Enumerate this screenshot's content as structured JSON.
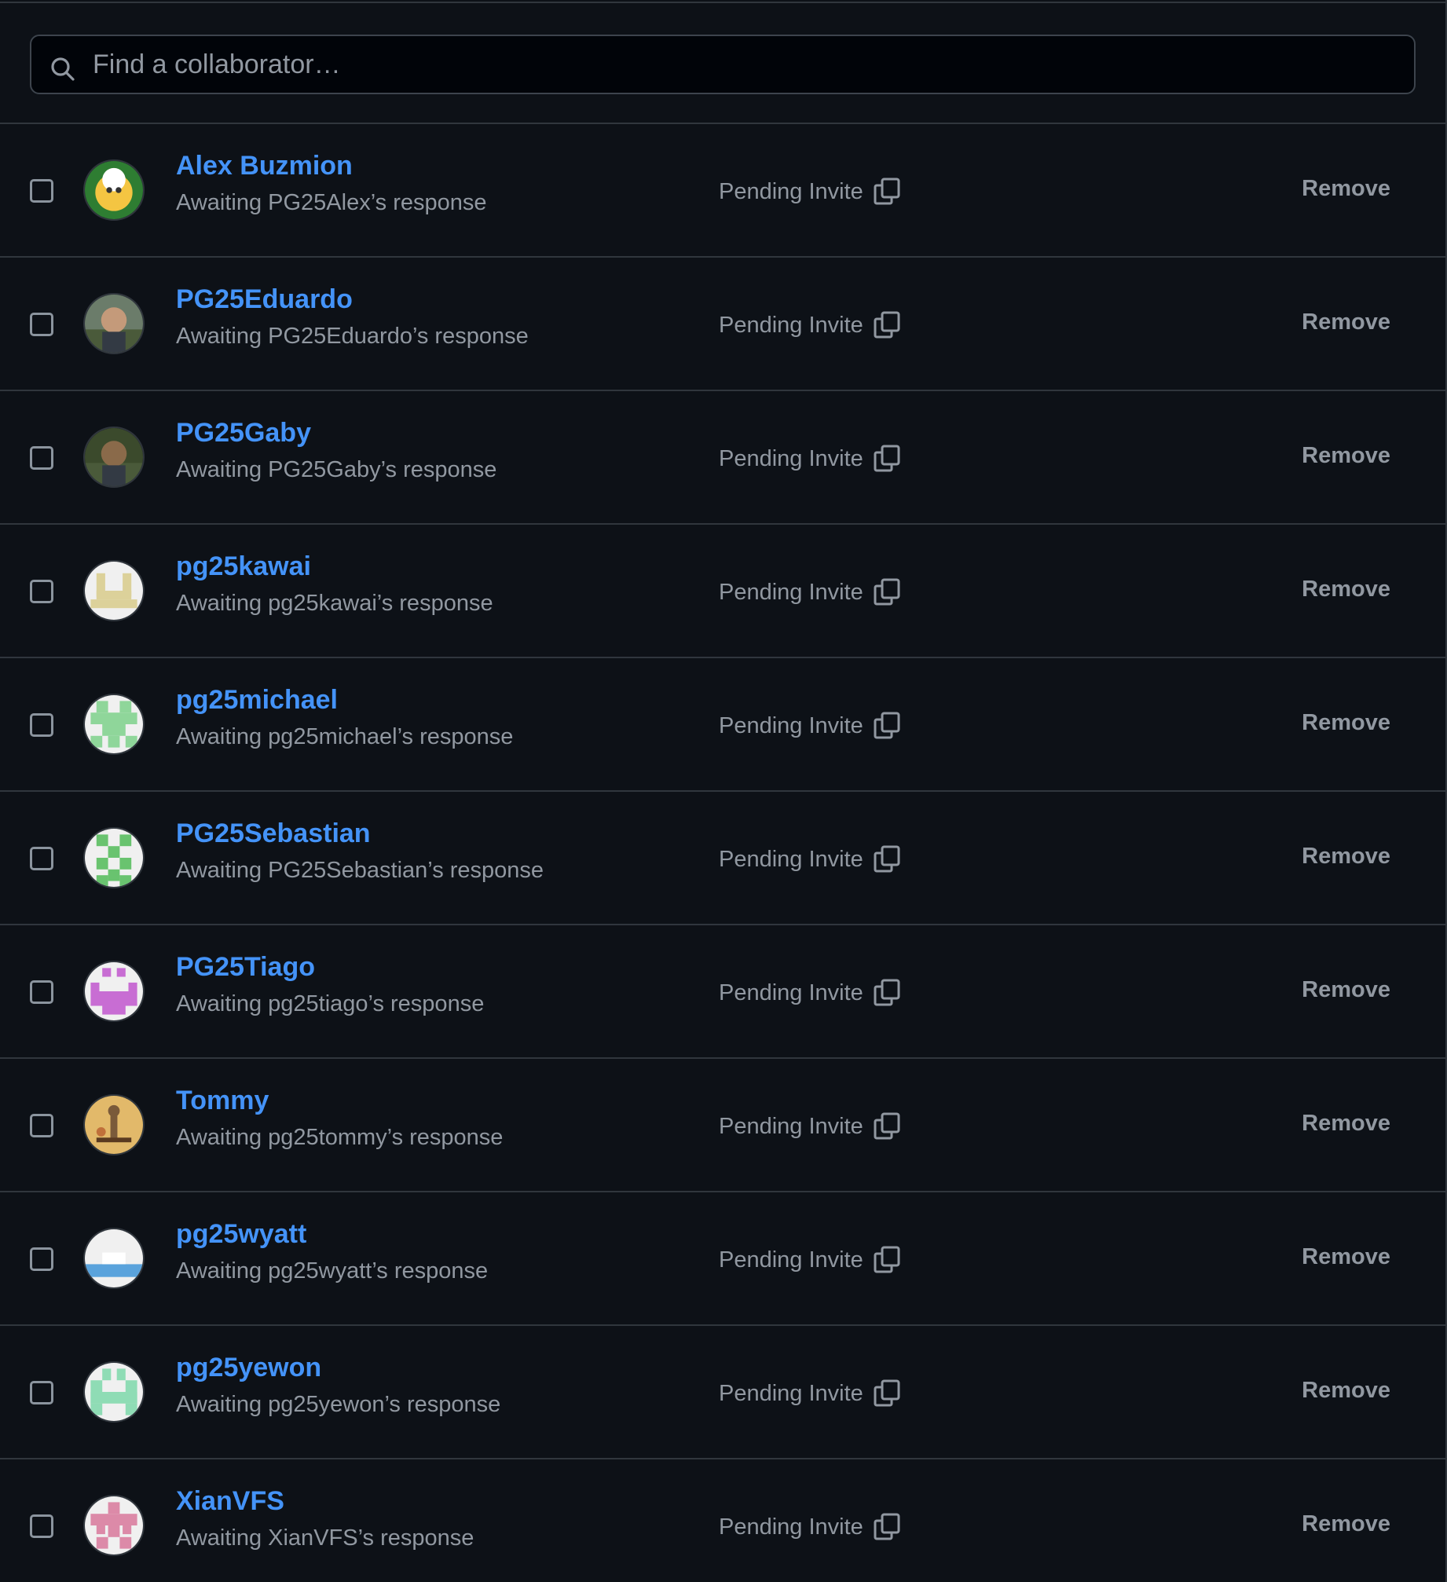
{
  "search": {
    "placeholder": "Find a collaborator…",
    "icon": "search-icon"
  },
  "collaborators": [
    {
      "name": "Alex Buzmion",
      "status_text": "Awaiting PG25Alex’s response",
      "pending_label": "Pending Invite",
      "remove_label": "Remove",
      "avatar_colors": [
        "#2e7d32",
        "#f4c542"
      ]
    },
    {
      "name": "PG25Eduardo",
      "status_text": "Awaiting PG25Eduardo’s response",
      "pending_label": "Pending Invite",
      "remove_label": "Remove",
      "avatar_colors": [
        "#6b7c6a",
        "#c49a7a"
      ]
    },
    {
      "name": "PG25Gaby",
      "status_text": "Awaiting PG25Gaby’s response",
      "pending_label": "Pending Invite",
      "remove_label": "Remove",
      "avatar_colors": [
        "#3b4a2c",
        "#8a6a4a"
      ]
    },
    {
      "name": "pg25kawai",
      "status_text": "Awaiting pg25kawai’s response",
      "pending_label": "Pending Invite",
      "remove_label": "Remove",
      "avatar_colors": [
        "#f0f0f0",
        "#dcd19a"
      ]
    },
    {
      "name": "pg25michael",
      "status_text": "Awaiting pg25michael’s response",
      "pending_label": "Pending Invite",
      "remove_label": "Remove",
      "avatar_colors": [
        "#f0f0f0",
        "#8fd69a"
      ]
    },
    {
      "name": "PG25Sebastian",
      "status_text": "Awaiting PG25Sebastian’s response",
      "pending_label": "Pending Invite",
      "remove_label": "Remove",
      "avatar_colors": [
        "#f0f0f0",
        "#69c36f"
      ]
    },
    {
      "name": "PG25Tiago",
      "status_text": "Awaiting pg25tiago’s response",
      "pending_label": "Pending Invite",
      "remove_label": "Remove",
      "avatar_colors": [
        "#f0f0f0",
        "#c86dd3"
      ]
    },
    {
      "name": "Tommy",
      "status_text": "Awaiting pg25tommy’s response",
      "pending_label": "Pending Invite",
      "remove_label": "Remove",
      "avatar_colors": [
        "#e2b96a",
        "#7a5a3a"
      ]
    },
    {
      "name": "pg25wyatt",
      "status_text": "Awaiting pg25wyatt’s response",
      "pending_label": "Pending Invite",
      "remove_label": "Remove",
      "avatar_colors": [
        "#f0f0f0",
        "#5aa3dc"
      ]
    },
    {
      "name": "pg25yewon",
      "status_text": "Awaiting pg25yewon’s response",
      "pending_label": "Pending Invite",
      "remove_label": "Remove",
      "avatar_colors": [
        "#f0f0f0",
        "#8fdcb5"
      ]
    },
    {
      "name": "XianVFS",
      "status_text": "Awaiting XianVFS’s response",
      "pending_label": "Pending Invite",
      "remove_label": "Remove",
      "avatar_colors": [
        "#f0f0f0",
        "#dc8aa8"
      ]
    }
  ],
  "colors": {
    "background": "#0d1117",
    "border": "#30363d",
    "link": "#4493f8",
    "muted": "#9198a1"
  }
}
